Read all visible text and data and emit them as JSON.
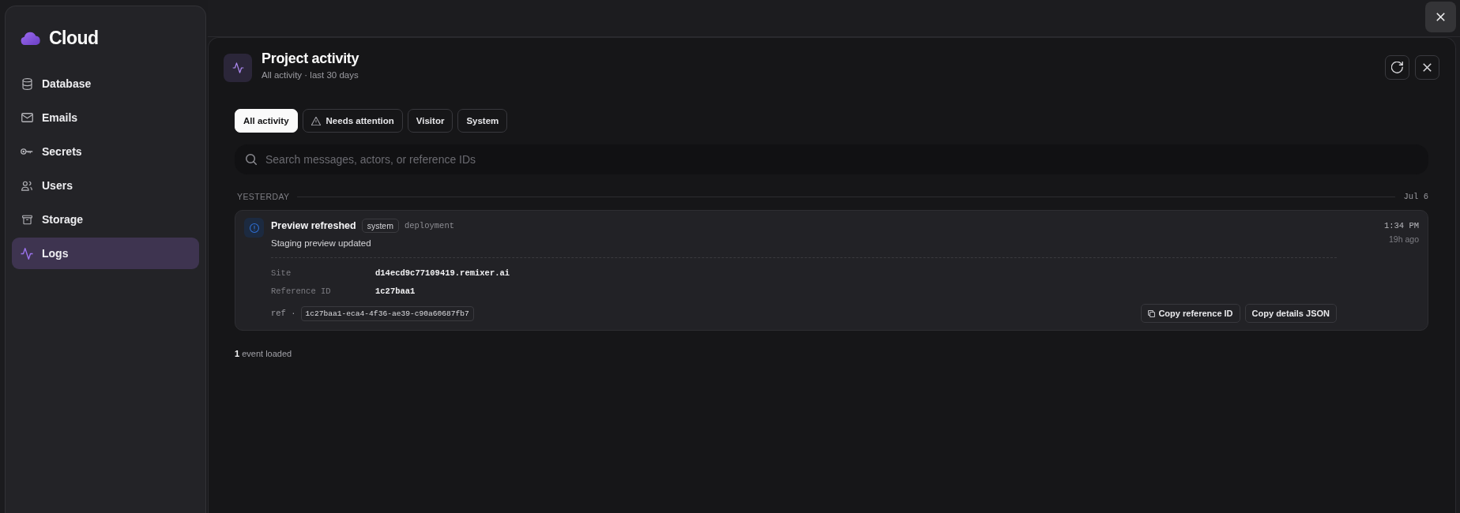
{
  "sidebar": {
    "brand": "Cloud",
    "items": [
      {
        "label": "Database",
        "selected": false
      },
      {
        "label": "Emails",
        "selected": false
      },
      {
        "label": "Secrets",
        "selected": false
      },
      {
        "label": "Users",
        "selected": false
      },
      {
        "label": "Storage",
        "selected": false
      },
      {
        "label": "Logs",
        "selected": true
      }
    ]
  },
  "panel": {
    "title": "Project activity",
    "subtitle": "All activity · last 30 days"
  },
  "tabs": [
    {
      "label": "All activity",
      "kind": "plain",
      "selected": true
    },
    {
      "label": "Needs attention",
      "kind": "warning",
      "selected": false
    },
    {
      "label": "Visitor",
      "kind": "plain",
      "selected": false
    },
    {
      "label": "System",
      "kind": "plain",
      "selected": false
    }
  ],
  "search": {
    "placeholder": "Search messages, actors, or reference IDs"
  },
  "sections": [
    {
      "label": "YESTERDAY",
      "date": "Jul 6",
      "events": [
        {
          "title": "Preview refreshed",
          "tag": "system",
          "category": "deployment",
          "message": "Staging preview updated",
          "time": "1:34 PM",
          "ago": "19h ago",
          "details": [
            {
              "label": "Site",
              "value": "d14ecd9c77109419.remixer.ai"
            },
            {
              "label": "Reference ID",
              "value": "1c27baa1"
            }
          ],
          "ref_label": "ref ·",
          "ref": "1c27baa1-eca4-4f36-ae39-c90a60687fb7",
          "actions": [
            {
              "label": "Copy reference ID",
              "kind": "copy"
            },
            {
              "label": "Copy details JSON",
              "kind": "plain"
            }
          ]
        }
      ]
    }
  ],
  "footer": {
    "count": "**1** event loaded"
  }
}
